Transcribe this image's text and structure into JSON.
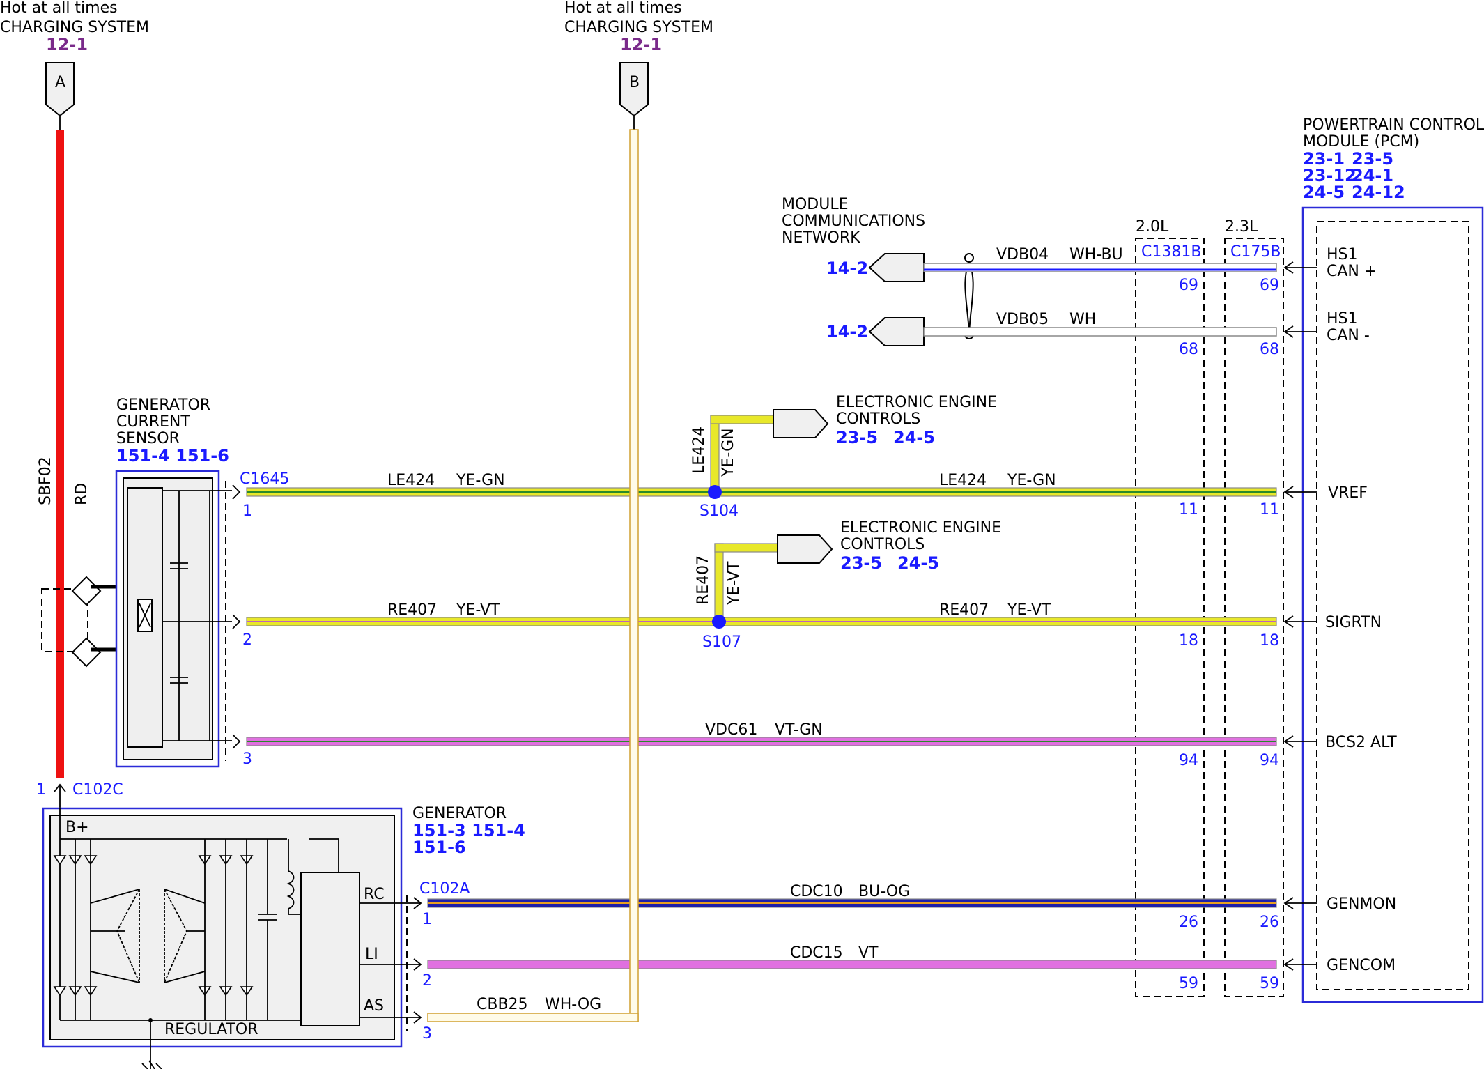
{
  "top_connectors": {
    "a": {
      "caption1": "Hot at all times",
      "caption2": "CHARGING SYSTEM",
      "ref": "12-1",
      "letter": "A"
    },
    "b": {
      "caption1": "Hot at all times",
      "caption2": "CHARGING SYSTEM",
      "ref": "12-1",
      "letter": "B"
    }
  },
  "power_wire": {
    "circuit": "SBF02",
    "color": "RD",
    "pin": "1",
    "connector": "C102C"
  },
  "current_sensor": {
    "line1": "GENERATOR",
    "line2": "CURRENT",
    "line3": "SENSOR",
    "refs": "151-4 151-6",
    "connector": "C1645"
  },
  "generator": {
    "label": "GENERATOR",
    "refs1": "151-3 151-4",
    "refs2": "151-6",
    "bplus": "B+",
    "regulator": "REGULATOR",
    "connector": "C102A",
    "rc": "RC",
    "li": "LI",
    "as": "AS"
  },
  "network": {
    "line1": "MODULE",
    "line2": "COMMUNICATIONS",
    "line3": "NETWORK",
    "ref1": "14-2",
    "ref2": "14-2"
  },
  "eec1": {
    "line1": "ELECTRONIC ENGINE",
    "line2": "CONTROLS",
    "ref1": "23-5",
    "ref2": "24-5"
  },
  "eec2": {
    "line1": "ELECTRONIC ENGINE",
    "line2": "CONTROLS",
    "ref1": "23-5",
    "ref2": "24-5"
  },
  "splices": {
    "s104": "S104",
    "s107": "S107"
  },
  "engine_columns": {
    "col1_label": "2.0L",
    "col1_conn": "C1381B",
    "col2_label": "2.3L",
    "col2_conn": "C175B"
  },
  "pcm": {
    "line1": "POWERTRAIN CONTROL",
    "line2": "MODULE (PCM)",
    "refs_row1_a": "23-1",
    "refs_row1_b": "23-5",
    "refs_row2_a": "23-12",
    "refs_row2_b": "24-1",
    "refs_row3_a": "24-5",
    "refs_row3_b": "24-12"
  },
  "wires": [
    {
      "circuit": "VDB04",
      "color": "WH-BU",
      "pin_a": "69",
      "pin_b": "69",
      "pcm_label1": "HS1",
      "pcm_label2": "CAN +"
    },
    {
      "circuit": "VDB05",
      "color": "WH",
      "pin_a": "68",
      "pin_b": "68",
      "pcm_label1": "HS1",
      "pcm_label2": "CAN -"
    },
    {
      "circuit": "LE424",
      "color": "YE-GN",
      "pin_sensor": "1",
      "pin_a": "11",
      "pin_b": "11",
      "pcm_label": "VREF"
    },
    {
      "circuit": "RE407",
      "color": "YE-VT",
      "pin_sensor": "2",
      "pin_a": "18",
      "pin_b": "18",
      "pcm_label": "SIGRTN"
    },
    {
      "circuit": "VDC61",
      "color": "VT-GN",
      "pin_sensor": "3",
      "pin_a": "94",
      "pin_b": "94",
      "pcm_label": "BCS2 ALT"
    },
    {
      "circuit": "CDC10",
      "color": "BU-OG",
      "pin_gen": "1",
      "pin_a": "26",
      "pin_b": "26",
      "pcm_label": "GENMON"
    },
    {
      "circuit": "CDC15",
      "color": "VT",
      "pin_gen": "2",
      "pin_a": "59",
      "pin_b": "59",
      "pcm_label": "GENCOM"
    },
    {
      "circuit": "CBB25",
      "color": "WH-OG",
      "pin_gen": "3"
    }
  ],
  "colors": {
    "red": "#ee1111",
    "yellow": "#e8e82a",
    "blue": "#1a1aff",
    "violet": "#e070e0",
    "navy": "#1e1ea8"
  }
}
